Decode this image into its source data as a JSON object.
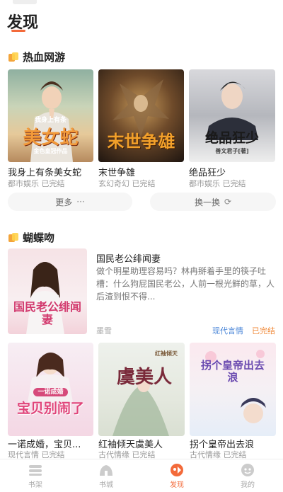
{
  "header": {
    "title": "发现"
  },
  "section1": {
    "title": "热血网游",
    "books": [
      {
        "name": "我身上有条美女蛇",
        "meta": "都市娱乐 已完结",
        "cover_text": "美女蛇",
        "cover_sub": "我身上有条",
        "cover_author": "金色皇冠作品"
      },
      {
        "name": "末世争雄",
        "meta": "玄幻奇幻 已完结",
        "cover_text": "末世争雄"
      },
      {
        "name": "绝品狂少",
        "meta": "都市娱乐 已完结",
        "cover_text": "绝品狂少",
        "cover_author": "善文君子[著]"
      }
    ],
    "more_label": "更多",
    "more_icon": "···",
    "refresh_label": "换一换",
    "refresh_icon": "⟳"
  },
  "section2": {
    "title": "蝴蝶吻",
    "featured": {
      "title": "国民老公绯闻妻",
      "desc": "做个明星助理容易吗？林冉掰着手里的筷子吐槽：什么狗屁国民老公，人前一根光鲜的草，人后渣到恨不得...",
      "author": "墨雪",
      "tag": "现代言情",
      "status": "已完结",
      "cover_text": "国民老公绯闻妻"
    },
    "books": [
      {
        "name": "一诺成婚，宝贝...",
        "meta": "现代言情 已完结",
        "cover_text": "宝贝别闹了",
        "cover_sub": "一诺成婚"
      },
      {
        "name": "红袖倾天虞美人",
        "meta": "古代情缘 已完结",
        "cover_text": "虞美人",
        "cover_sub": "红袖倾天"
      },
      {
        "name": "拐个皇帝出去浪",
        "meta": "古代情缘 已完结",
        "cover_text": "拐个皇帝出去浪"
      }
    ]
  },
  "tabbar": {
    "items": [
      {
        "label": "书架"
      },
      {
        "label": "书城"
      },
      {
        "label": "发现"
      },
      {
        "label": "我的"
      }
    ],
    "active": "发现",
    "active_color": "#f36a3a"
  }
}
